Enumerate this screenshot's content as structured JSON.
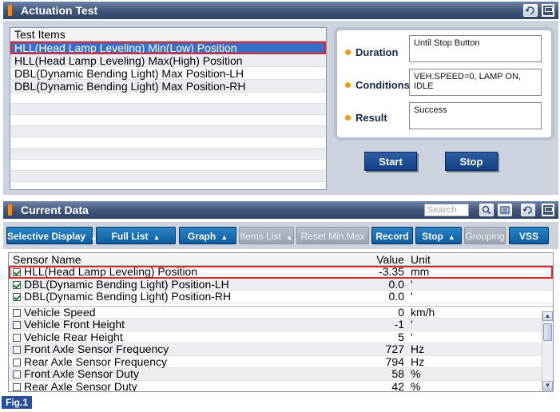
{
  "actuation": {
    "title": "Actuation Test",
    "list_header": "Test Items",
    "items": [
      "HLL(Head Lamp Leveling) Min(Low) Position",
      "HLL(Head Lamp Leveling) Max(High) Position",
      "DBL(Dynamic Bending Light) Max Position-LH",
      "DBL(Dynamic Bending Light) Max Position-RH"
    ],
    "selected_index": 0,
    "duration_label": "Duration",
    "duration_value": "Until Stop Button",
    "conditions_label": "Conditions",
    "conditions_value": "VEH.SPEED=0, LAMP ON, IDLE",
    "result_label": "Result",
    "result_value": "Success",
    "start_label": "Start",
    "stop_label": "Stop"
  },
  "current_data": {
    "title": "Current Data",
    "search_placeholder": "Search",
    "toolbar": {
      "selective_display": "Selective Display",
      "full_list": "Full List",
      "graph": "Graph",
      "items_list": "Items List",
      "reset_minmax": "Reset Min.Max",
      "record": "Record",
      "stop": "Stop",
      "grouping": "Grouping",
      "vss": "VSS"
    },
    "headers": {
      "name": "Sensor Name",
      "value": "Value",
      "unit": "Unit"
    },
    "checked_rows": [
      {
        "name": "HLL(Head Lamp Leveling) Position",
        "value": "-3.35",
        "unit": "mm"
      },
      {
        "name": "DBL(Dynamic Bending Light) Position-LH",
        "value": "0.0",
        "unit": "'"
      },
      {
        "name": "DBL(Dynamic Bending Light) Position-RH",
        "value": "0.0",
        "unit": "'"
      }
    ],
    "rows": [
      {
        "name": "Vehicle Speed",
        "value": "0",
        "unit": "km/h"
      },
      {
        "name": "Vehicle Front Height",
        "value": "-1",
        "unit": "'"
      },
      {
        "name": "Vehicle Rear Height",
        "value": "5",
        "unit": "'"
      },
      {
        "name": "Front Axle Sensor Frequency",
        "value": "727",
        "unit": "Hz"
      },
      {
        "name": "Rear Axle Sensor Frequency",
        "value": "794",
        "unit": "Hz"
      },
      {
        "name": "Front Axle Sensor Duty",
        "value": "58",
        "unit": "%"
      },
      {
        "name": "Rear Axle Sensor Duty",
        "value": "42",
        "unit": "%"
      }
    ]
  },
  "figure_label": "Fig.1",
  "colors": {
    "selection": "#3a6fc8",
    "highlight_border": "#e1262f",
    "button_blue": "#0c5d9e",
    "title_bar": "#3e5479"
  }
}
